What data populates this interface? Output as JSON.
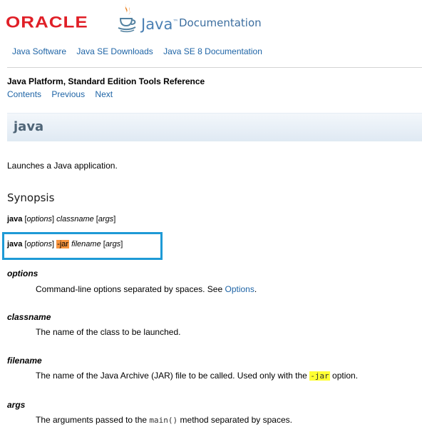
{
  "header": {
    "oracle_logo": "ORACLE",
    "java_word": "Java",
    "java_tm": "™",
    "documentation": "Documentation"
  },
  "topnav": [
    "Java Software",
    "Java SE Downloads",
    "Java SE 8 Documentation"
  ],
  "book": {
    "title": "Java Platform, Standard Edition Tools Reference",
    "nav": [
      "Contents",
      "Previous",
      "Next"
    ]
  },
  "page_title": "java",
  "intro": "Launches a Java application.",
  "synopsis": {
    "heading": "Synopsis",
    "line1": {
      "cmd": "java",
      "options": "options",
      "classname": "classname",
      "args": "args"
    },
    "line2": {
      "cmd": "java",
      "options": "options",
      "jar": "-jar",
      "filename": "filename",
      "args": "args"
    }
  },
  "terms": [
    {
      "term": "options",
      "def_before": "Command-line options separated by spaces. See ",
      "link": "Options",
      "def_after": "."
    },
    {
      "term": "classname",
      "def": "The name of the class to be launched."
    },
    {
      "term": "filename",
      "def_before": "The name of the Java Archive (JAR) file to be called. Used only with the ",
      "code": "-jar",
      "def_after": " option."
    },
    {
      "term": "args",
      "def_before": "The arguments passed to the ",
      "code": "main()",
      "def_after": " method separated by spaces."
    }
  ],
  "colors": {
    "oracle_red": "#e01f27",
    "link_blue": "#1e64a6",
    "highlight_box": "#1e9ad6",
    "jar_highlight": "#f7943e",
    "code_highlight": "#ffff33"
  }
}
